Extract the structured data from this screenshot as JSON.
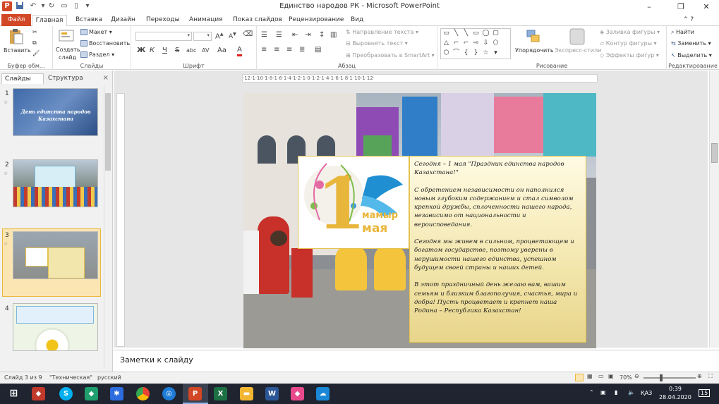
{
  "window": {
    "title": "Единство народов РК  -  Microsoft PowerPoint",
    "app_icon": "P"
  },
  "tabs": [
    "Файл",
    "Главная",
    "Вставка",
    "Дизайн",
    "Переходы",
    "Анимация",
    "Показ слайдов",
    "Рецензирование",
    "Вид"
  ],
  "ribbon": {
    "clipboard": {
      "paste": "Вставить",
      "label": "Буфер обм..."
    },
    "slides": {
      "create": "Создать",
      "create2": "слайд",
      "layout": "Макет",
      "reset": "Восстановить",
      "section": "Раздел",
      "label": "Слайды"
    },
    "font": {
      "label": "Шрифт",
      "bold": "Ж",
      "italic": "К",
      "underline": "Ч",
      "strike": "S",
      "shadow": "abc",
      "spacing": "AV",
      "case": "Aa",
      "color": "A",
      "grow": "A",
      "shrink": "A"
    },
    "paragraph": {
      "label": "Абзац",
      "direction": "Направление текста",
      "align_text": "Выровнять текст",
      "smartart": "Преобразовать в SmartArt"
    },
    "drawing": {
      "label": "Рисование",
      "arrange": "Упорядочить",
      "quick_styles": "Экспресс-стили",
      "fill": "Заливка фигуры",
      "outline": "Контур фигуры",
      "effects": "Эффекты фигур"
    },
    "editing": {
      "label": "Редактирование",
      "find": "Найти",
      "replace": "Заменить",
      "select": "Выделить"
    }
  },
  "left_pane": {
    "tab_slides": "Слайды",
    "tab_outline": "Структура",
    "close": "×",
    "thumbs": [
      {
        "num": "1",
        "title": "День единства народов Казахстана"
      },
      {
        "num": "2"
      },
      {
        "num": "3"
      },
      {
        "num": "4"
      }
    ]
  },
  "ruler_top": "·12·1·10·1·8·1·6·1·4·1·2·1·0·1·2·1·4·1·6·1·8·1·10·1·12·",
  "slide": {
    "logo_number": "1",
    "logo_word1": "мамыр",
    "logo_word2": "мая",
    "paragraphs": [
      "Сегодня – 1 мая \"Праздник единства народов Казахстана!\"",
      "С обретением независимости он наполнился новым глубоким содержанием и стал символом крепкой дружбы, сплоченности нашего народа, независимо от национальности и вероисповедания.",
      "Сегодня мы живем в сильном, процветающем и богатом государстве, поэтому уверены в нерушимости нашего единства, успешном будущем своей страны и наших детей.",
      "В этот праздничный день желаю вам, вашим семьям и близким благополучия, счастья, мира и добра! Пусть процветает и крепнет наша Родина – Республика Казахстан!"
    ]
  },
  "notes": {
    "placeholder": "Заметки к слайду"
  },
  "status": {
    "slide_of": "Слайд 3 из 9",
    "theme": "\"Техническая\"",
    "language": "русский",
    "zoom": "70%"
  },
  "taskbar": {
    "lang": "ҚАЗ",
    "time": "0:39",
    "date": "28.04.2020",
    "notif_count": "15"
  },
  "colors": {
    "accent": "#d24726",
    "selection": "#fbe6b3",
    "text_box_border": "#e3c24e",
    "logo_blue": "#1f8fd1",
    "logo_gold": "#e8b63b"
  }
}
